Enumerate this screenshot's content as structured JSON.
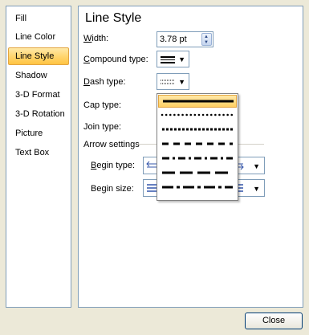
{
  "sidebar": {
    "items": [
      {
        "label": "Fill"
      },
      {
        "label": "Line Color"
      },
      {
        "label": "Line Style",
        "active": true
      },
      {
        "label": "Shadow"
      },
      {
        "label": "3-D Format"
      },
      {
        "label": "3-D Rotation"
      },
      {
        "label": "Picture"
      },
      {
        "label": "Text Box"
      }
    ]
  },
  "panel": {
    "title": "Line Style",
    "width": {
      "label_u": "W",
      "label_rest": "idth:",
      "value": "3.78 pt"
    },
    "compound": {
      "label_u": "C",
      "label_rest": "ompound type:"
    },
    "dash": {
      "label_u": "D",
      "label_rest": "ash type:"
    },
    "cap": {
      "label": "Cap type:"
    },
    "join": {
      "label": "Join type:"
    },
    "arrow_settings": {
      "label": "Arrow settings"
    },
    "begin_type": {
      "label_u": "B",
      "label_rest": "egin type:"
    },
    "begin_size": {
      "label": "Begin size:"
    }
  },
  "dash_options": [
    "solid",
    "round-dot",
    "square-dot",
    "dash",
    "dash-dot",
    "long-dash",
    "long-dash-dot"
  ],
  "buttons": {
    "close": "Close"
  },
  "colors": {
    "accent": "#ffd46b",
    "border": "#7f9db9",
    "background": "#ece9d8"
  }
}
